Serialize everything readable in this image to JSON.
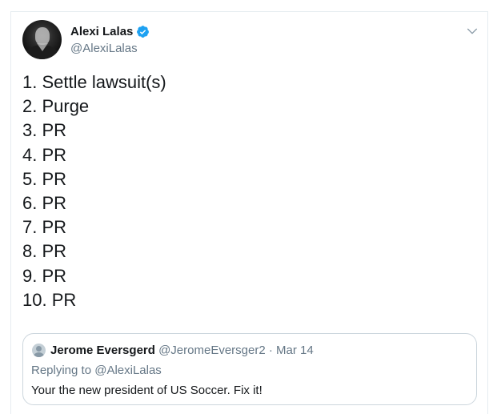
{
  "colors": {
    "verified_badge": "#1da1f2",
    "secondary_text": "#657786",
    "primary_text": "#14171a",
    "border": "#ccd6dd"
  },
  "tweet": {
    "author_name": "Alexi Lalas",
    "author_handle": "@AlexiLalas",
    "verified": true,
    "avatar_icon": "profile-photo",
    "menu_icon": "chevron-down-icon",
    "lines": [
      "1. Settle lawsuit(s)",
      "2. Purge",
      "3. PR",
      "4. PR",
      "5. PR",
      "6. PR",
      "7. PR",
      "8. PR",
      "9. PR",
      "10. PR"
    ]
  },
  "quoted_tweet": {
    "author_name": "Jerome Eversgerd",
    "meta": "@JeromeEversger2 · Mar 14",
    "replying_to": "Replying to @AlexiLalas",
    "text": "Your the new president of US Soccer. Fix it!",
    "avatar_icon": "default-avatar-icon"
  }
}
